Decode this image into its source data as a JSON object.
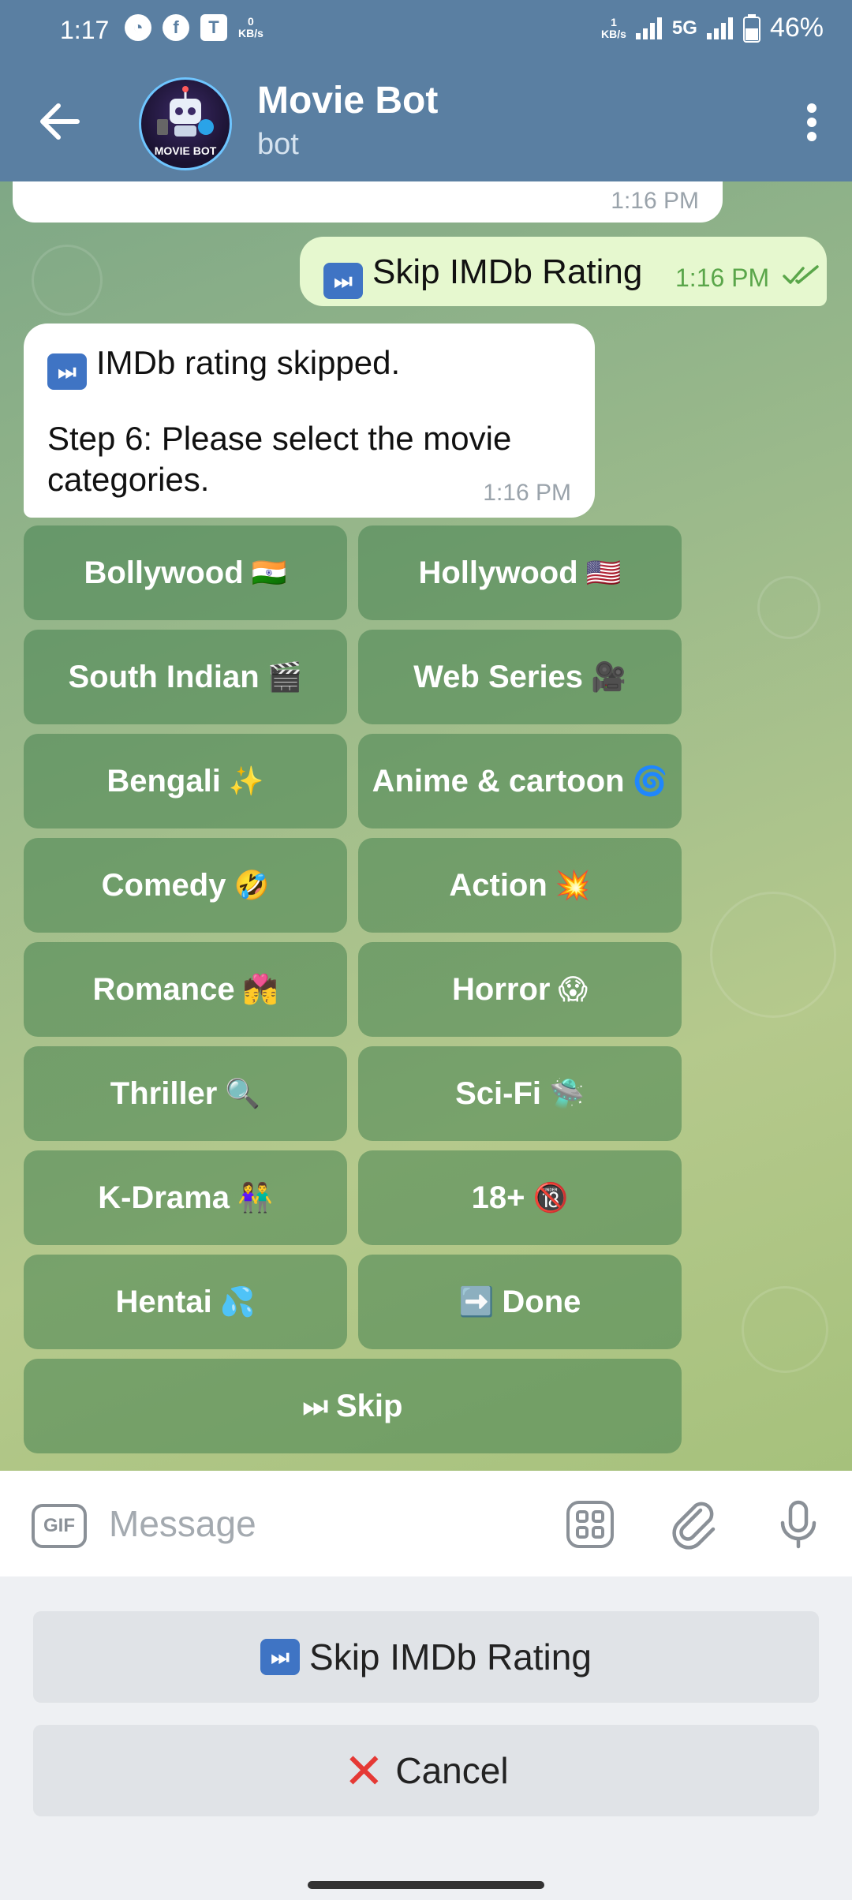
{
  "status_bar": {
    "time": "1:17",
    "net_left": "0",
    "net_left_unit": "KB/s",
    "net_right": "1",
    "net_right_unit": "KB/s",
    "network": "5G",
    "battery": "46%"
  },
  "header": {
    "title": "Movie Bot",
    "subtitle": "bot",
    "avatar_text": "MOVIE BOT"
  },
  "messages": {
    "prev_time": "1:16 PM",
    "outgoing": {
      "emoji": "⏭",
      "text": "Skip IMDb Rating",
      "time": "1:16 PM"
    },
    "incoming": {
      "emoji": "⏭",
      "line1": "IMDb rating skipped.",
      "line2": "Step 6: Please select the movie categories.",
      "time": "1:16 PM"
    }
  },
  "inline_keyboard": [
    {
      "label": "Bollywood",
      "emoji": "🇮🇳"
    },
    {
      "label": "Hollywood",
      "emoji": "🇺🇸"
    },
    {
      "label": "South Indian",
      "emoji": "🎬"
    },
    {
      "label": "Web Series",
      "emoji": "🎥"
    },
    {
      "label": "Bengali",
      "emoji": "✨"
    },
    {
      "label": "Anime & cartoon",
      "emoji": "🌀"
    },
    {
      "label": "Comedy",
      "emoji": "🤣"
    },
    {
      "label": "Action",
      "emoji": "💥"
    },
    {
      "label": "Romance",
      "emoji": "💏"
    },
    {
      "label": "Horror",
      "emoji": "😱"
    },
    {
      "label": "Thriller",
      "emoji": "🔍"
    },
    {
      "label": "Sci-Fi",
      "emoji": "🛸"
    },
    {
      "label": "K-Drama",
      "emoji": "👫"
    },
    {
      "label": "18+",
      "emoji": "🔞"
    },
    {
      "label": "Hentai",
      "emoji": "💦"
    },
    {
      "label": "Done",
      "emoji": "➡️"
    },
    {
      "label": "Skip",
      "emoji": "⏭"
    }
  ],
  "input": {
    "gif": "GIF",
    "placeholder": "Message"
  },
  "reply_keyboard": {
    "skip_emoji": "⏭",
    "skip_label": "Skip IMDb Rating",
    "cancel_emoji": "✕",
    "cancel_label": "Cancel"
  },
  "colors": {
    "header": "#5a7fa2",
    "outgoing_bubble": "#e6f8cf",
    "keyboard_button": "#46825a",
    "cancel_x": "#e53935"
  }
}
